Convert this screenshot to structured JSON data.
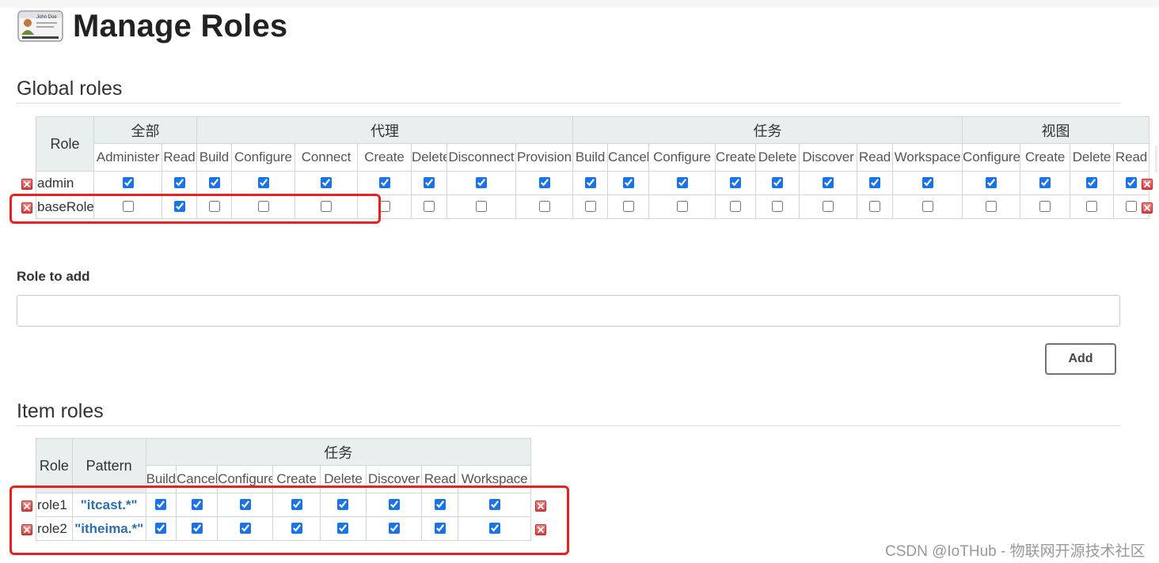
{
  "page": {
    "title": "Manage Roles"
  },
  "icons": {
    "title_icon": "id-card-icon",
    "delete_icon": "delete-red-x-icon"
  },
  "colors": {
    "pattern_text": "#2f6eac",
    "highlight_border": "#e52222",
    "checkbox_accent": "#1a73e8",
    "header_bg": "#e9eeee"
  },
  "id_card": {
    "name": "John Doe"
  },
  "global_roles": {
    "title": "Global roles",
    "role_header": "Role",
    "groups": [
      {
        "label": "全部",
        "span": 2
      },
      {
        "label": "代理",
        "span": 7
      },
      {
        "label": "任务",
        "span": 8
      },
      {
        "label": "视图",
        "span": 4
      }
    ],
    "permissions": [
      "Administer",
      "Read",
      "Build",
      "Configure",
      "Connect",
      "Create",
      "Delete",
      "Disconnect",
      "Provision",
      "Build",
      "Cancel",
      "Configure",
      "Create",
      "Delete",
      "Discover",
      "Read",
      "Workspace",
      "Configure",
      "Create",
      "Delete",
      "Read"
    ],
    "rows": [
      {
        "name": "admin",
        "checked": [
          1,
          1,
          1,
          1,
          1,
          1,
          1,
          1,
          1,
          1,
          1,
          1,
          1,
          1,
          1,
          1,
          1,
          1,
          1,
          1,
          1
        ]
      },
      {
        "name": "baseRole",
        "checked": [
          0,
          1,
          0,
          0,
          0,
          0,
          0,
          0,
          0,
          0,
          0,
          0,
          0,
          0,
          0,
          0,
          0,
          0,
          0,
          0,
          0
        ]
      }
    ]
  },
  "role_to_add": {
    "label": "Role to add",
    "value": "",
    "placeholder": "",
    "add_button": "Add"
  },
  "item_roles": {
    "title": "Item roles",
    "role_header": "Role",
    "pattern_header": "Pattern",
    "groups": [
      {
        "label": "任务",
        "span": 8
      }
    ],
    "permissions": [
      "Build",
      "Cancel",
      "Configure",
      "Create",
      "Delete",
      "Discover",
      "Read",
      "Workspace"
    ],
    "rows": [
      {
        "name": "role1",
        "pattern": "\"itcast.*\"",
        "checked": [
          1,
          1,
          1,
          1,
          1,
          1,
          1,
          1
        ]
      },
      {
        "name": "role2",
        "pattern": "\"itheima.*\"",
        "checked": [
          1,
          1,
          1,
          1,
          1,
          1,
          1,
          1
        ]
      }
    ]
  },
  "watermark": "CSDN @IoTHub - 物联网开源技术社区"
}
